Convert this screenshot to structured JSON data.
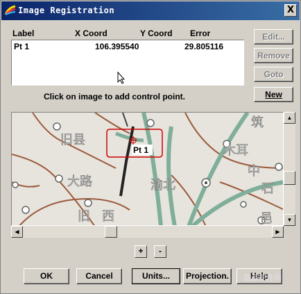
{
  "window": {
    "title": "Image Registration",
    "close_label": "X"
  },
  "table": {
    "headers": [
      "Label",
      "X Coord",
      "Y Coord",
      "Error"
    ],
    "rows": [
      {
        "label": "Pt 1",
        "x": "106.395540",
        "y": "29.805116"
      }
    ],
    "error_value": "29.805116"
  },
  "side_buttons": {
    "edit": "Edit...",
    "remove": "Remove",
    "goto": "Goto",
    "new": "New"
  },
  "instruction": "Click on image to add control point.",
  "map": {
    "point_label": "Pt 1",
    "place_names": [
      "旧县",
      "大路",
      "渝北",
      "木耳",
      "中",
      "筑",
      "旧",
      "石",
      "西",
      "邑"
    ]
  },
  "zoom": {
    "plus": "+",
    "minus": "-"
  },
  "bottom_buttons": {
    "ok": "OK",
    "cancel": "Cancel",
    "units": "Units...",
    "projection": "Projection.",
    "help": "Help"
  },
  "watermark": "载都控件网",
  "colors": {
    "title_start": "#0a246a",
    "title_end": "#3a6ea5",
    "face": "#d4d0c8",
    "road_green": "#7fae9a",
    "road_brown": "#9c5a3c",
    "marker_red": "#cc0000"
  }
}
